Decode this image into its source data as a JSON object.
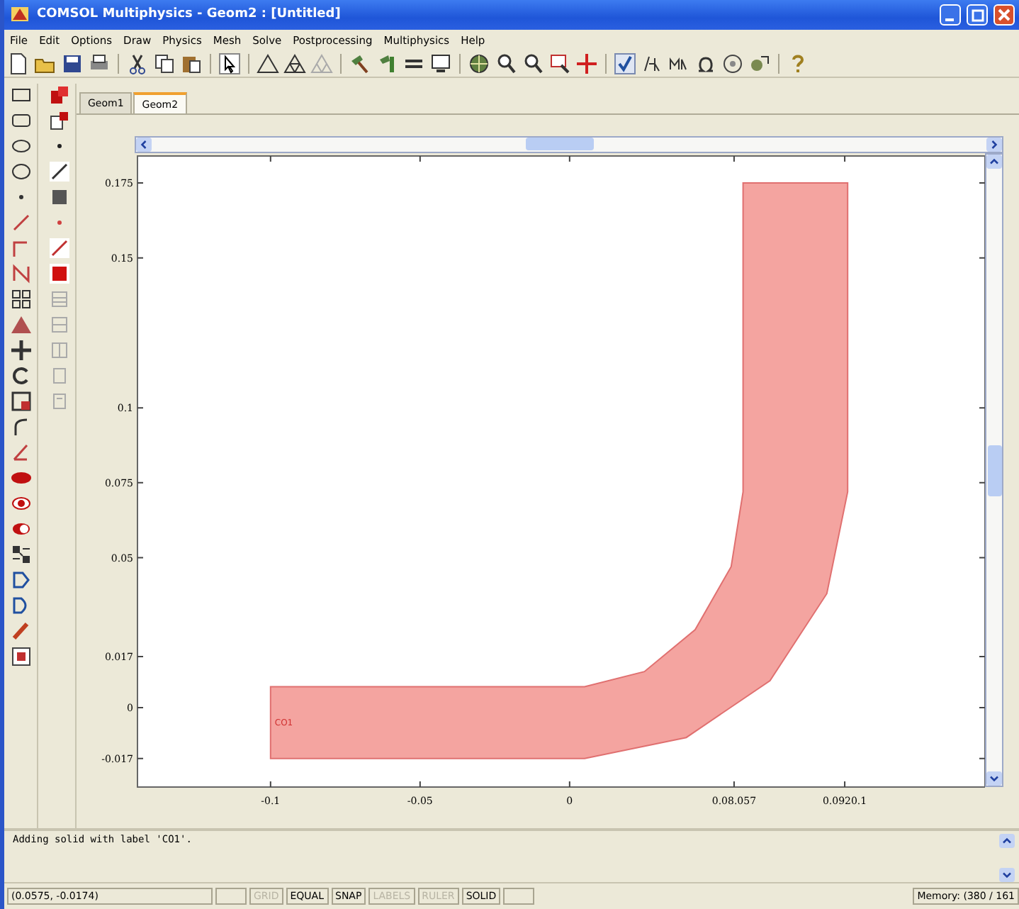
{
  "window": {
    "title": "COMSOL Multiphysics - Geom2 : [Untitled]"
  },
  "menu": [
    "File",
    "Edit",
    "Options",
    "Draw",
    "Physics",
    "Mesh",
    "Solve",
    "Postprocessing",
    "Multiphysics",
    "Help"
  ],
  "tabs": [
    {
      "label": "Geom1",
      "selected": false
    },
    {
      "label": "Geom2",
      "selected": true
    }
  ],
  "plot": {
    "chart_data": {
      "type": "area",
      "xlim": [
        -0.1445,
        0.1389
      ],
      "ylim": [
        -0.0265,
        0.184
      ],
      "xticks": [
        {
          "value": -0.1,
          "label": "-0.1"
        },
        {
          "value": -0.05,
          "label": "-0.05"
        },
        {
          "value": 0,
          "label": "0"
        },
        {
          "value": 0.055,
          "label": "0.08.057"
        },
        {
          "value": 0.092,
          "label": "0.0920.1"
        }
      ],
      "yticks": [
        {
          "value": 0.175,
          "label": "0.175"
        },
        {
          "value": 0.15,
          "label": "0.15"
        },
        {
          "value": 0.1,
          "label": "0.1"
        },
        {
          "value": 0.075,
          "label": "0.075"
        },
        {
          "value": 0.05,
          "label": "0.05"
        },
        {
          "value": 0.017,
          "label": "0.017"
        },
        {
          "value": 0,
          "label": "0"
        },
        {
          "value": -0.017,
          "label": "-0.017"
        }
      ],
      "series": [
        {
          "name": "CO1",
          "color": "#f4a4a0",
          "x": [
            -0.1,
            0.005,
            0.039,
            0.067,
            0.086,
            0.093,
            0.093,
            0.058,
            0.058,
            0.054,
            0.042,
            0.025,
            0.005,
            -0.1
          ],
          "values": [
            -0.017,
            -0.017,
            -0.01,
            0.009,
            0.038,
            0.072,
            0.175,
            0.175,
            0.072,
            0.047,
            0.026,
            0.012,
            0.007,
            0.007
          ]
        }
      ]
    }
  },
  "log": [
    "Adding solid with label 'CO1'."
  ],
  "status_bar": {
    "coordinates": "(0.0575, -0.0174)",
    "toggles": [
      {
        "label": "GRID",
        "on": false
      },
      {
        "label": "EQUAL",
        "on": true
      },
      {
        "label": "SNAP",
        "on": true
      },
      {
        "label": "LABELS",
        "on": false
      },
      {
        "label": "RULER",
        "on": false
      },
      {
        "label": "SOLID",
        "on": true
      }
    ],
    "memory": "Memory: (380 / 161"
  }
}
